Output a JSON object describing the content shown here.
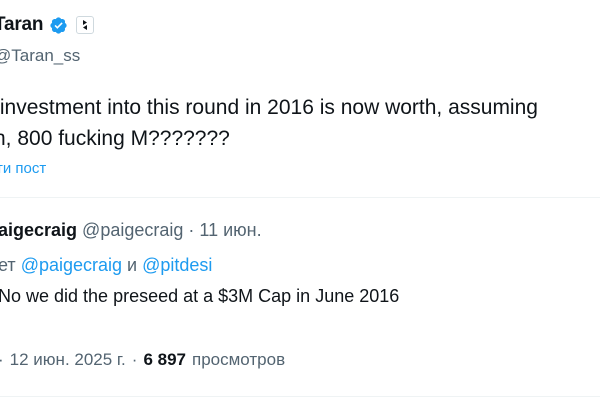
{
  "author": {
    "name": "Taran",
    "handle": "@Taran_ss"
  },
  "tweet": {
    "text": " investment into this round in 2016 is now worth, assuming\nn, 800 fucking M???????",
    "translate_label": "ти пост"
  },
  "quoted": {
    "name": "aigecraig",
    "handle": "@paigecraig",
    "separator": "·",
    "date": "11 июн.",
    "reply_prefix": "ет",
    "reply_mention_1": "@paigecraig",
    "reply_conjunction": "и",
    "reply_mention_2": "@pitdesi",
    "text": "No we did the preseed at a $3M Cap in June 2016"
  },
  "meta": {
    "separator": "·",
    "date": "12 июн. 2025 г.",
    "views_count": "6 897",
    "views_label": "просмотров"
  },
  "colors": {
    "text": "#0f1419",
    "secondary": "#536471",
    "accent": "#1d9bf0",
    "divider": "#eff3f4"
  }
}
